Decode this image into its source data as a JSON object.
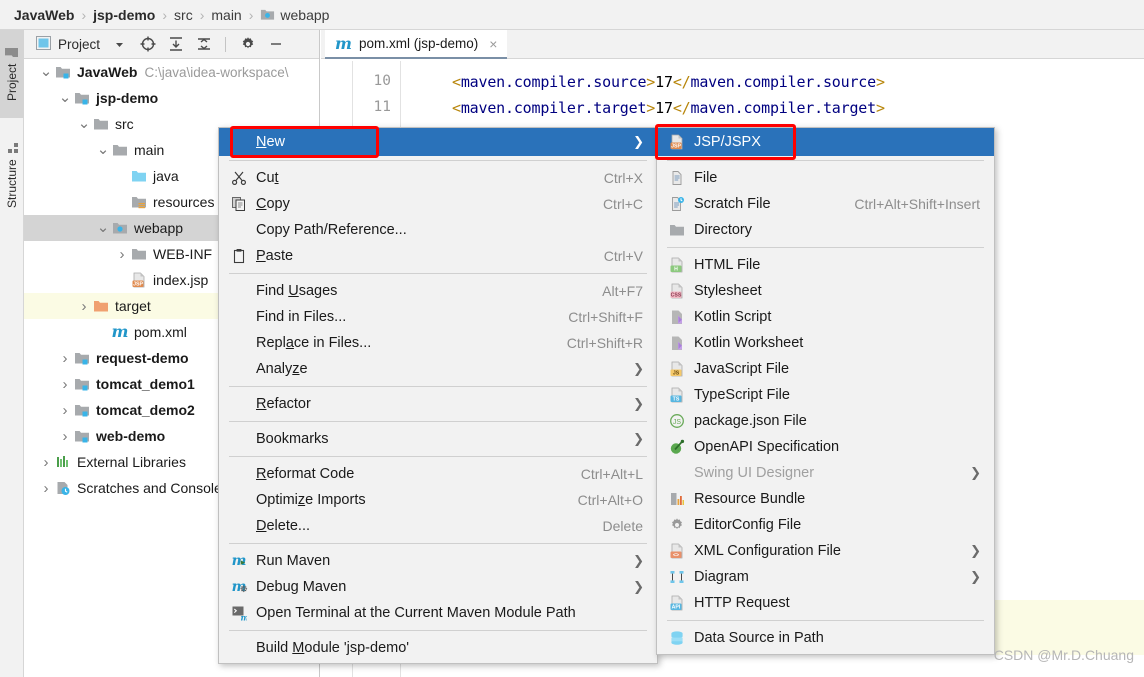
{
  "breadcrumb": {
    "items": [
      {
        "label": "JavaWeb",
        "bold": true,
        "icon": null
      },
      {
        "label": "jsp-demo",
        "bold": true,
        "icon": null
      },
      {
        "label": "src",
        "bold": false,
        "icon": null
      },
      {
        "label": "main",
        "bold": false,
        "icon": null
      },
      {
        "label": "webapp",
        "bold": false,
        "icon": "webapp-folder-icon"
      }
    ],
    "separator": "›"
  },
  "toolstrip": {
    "project_tab": "Project",
    "structure_tab": "Structure"
  },
  "project_panel": {
    "title": "Project",
    "buttons": [
      {
        "name": "project-view-dropdown",
        "glyph": "▾"
      },
      {
        "name": "select-opened-file-icon",
        "glyph": "⊕"
      },
      {
        "name": "expand-all-icon",
        "glyph": "⤓"
      },
      {
        "name": "collapse-all-icon",
        "glyph": "⤒"
      },
      {
        "name": "settings-gear-icon",
        "glyph": "⚙"
      },
      {
        "name": "hide-panel-icon",
        "glyph": "—"
      }
    ],
    "tree": [
      {
        "label": "JavaWeb",
        "path": "C:\\java\\idea-workspace\\",
        "indent": 0,
        "arrow": "⌄",
        "icon": "module-folder-icon",
        "bold": true,
        "state": "none"
      },
      {
        "label": "jsp-demo",
        "path": "",
        "indent": 1,
        "arrow": "⌄",
        "icon": "module-folder-icon",
        "bold": true,
        "state": "none"
      },
      {
        "label": "src",
        "path": "",
        "indent": 2,
        "arrow": "⌄",
        "icon": "folder-icon",
        "bold": false,
        "state": "none"
      },
      {
        "label": "main",
        "path": "",
        "indent": 3,
        "arrow": "⌄",
        "icon": "folder-icon",
        "bold": false,
        "state": "none"
      },
      {
        "label": "java",
        "path": "",
        "indent": 4,
        "arrow": "",
        "icon": "source-folder-icon",
        "bold": false,
        "state": "none"
      },
      {
        "label": "resources",
        "path": "",
        "indent": 4,
        "arrow": "",
        "icon": "resources-folder-icon",
        "bold": false,
        "state": "none"
      },
      {
        "label": "webapp",
        "path": "",
        "indent": 3,
        "arrow": "⌄",
        "icon": "webapp-folder-icon",
        "bold": false,
        "state": "selected"
      },
      {
        "label": "WEB-INF",
        "path": "",
        "indent": 4,
        "arrow": "›",
        "icon": "folder-icon",
        "bold": false,
        "state": "none"
      },
      {
        "label": "index.jsp",
        "path": "",
        "indent": 4,
        "arrow": "",
        "icon": "jsp-file-icon",
        "bold": false,
        "state": "none"
      },
      {
        "label": "target",
        "path": "",
        "indent": 2,
        "arrow": "›",
        "icon": "target-folder-icon",
        "bold": false,
        "state": "highlight"
      },
      {
        "label": "pom.xml",
        "path": "",
        "indent": 3,
        "arrow": "",
        "icon": "maven-file-icon",
        "bold": false,
        "state": "none"
      },
      {
        "label": "request-demo",
        "path": "",
        "indent": 1,
        "arrow": "›",
        "icon": "module-folder-icon",
        "bold": true,
        "state": "none"
      },
      {
        "label": "tomcat_demo1",
        "path": "",
        "indent": 1,
        "arrow": "›",
        "icon": "module-folder-icon",
        "bold": true,
        "state": "none"
      },
      {
        "label": "tomcat_demo2",
        "path": "",
        "indent": 1,
        "arrow": "›",
        "icon": "module-folder-icon",
        "bold": true,
        "state": "none"
      },
      {
        "label": "web-demo",
        "path": "",
        "indent": 1,
        "arrow": "›",
        "icon": "module-folder-icon",
        "bold": true,
        "state": "none"
      },
      {
        "label": "External Libraries",
        "path": "",
        "indent": 0,
        "arrow": "›",
        "icon": "libraries-icon",
        "bold": false,
        "state": "none"
      },
      {
        "label": "Scratches and Consoles",
        "path": "",
        "indent": 0,
        "arrow": "›",
        "icon": "scratches-icon",
        "bold": false,
        "state": "none"
      }
    ]
  },
  "editor": {
    "tab_label": "pom.xml (jsp-demo)",
    "tab_icon": "maven-file-icon",
    "tab_close": "×",
    "lines": [
      {
        "number": "10",
        "open_tag": "<maven.compiler.source>",
        "value": "17",
        "close_tag": "</maven.compiler.source>"
      },
      {
        "number": "11",
        "open_tag": "<maven.compiler.target>",
        "value": "17",
        "close_tag": "</maven.compiler.target>"
      }
    ]
  },
  "context_menu": {
    "items": [
      {
        "label": "New",
        "key": "",
        "icon": null,
        "arrow": true,
        "highlight": true,
        "mnemonic": "N"
      },
      {
        "sep": true
      },
      {
        "label": "Cut",
        "key": "Ctrl+X",
        "icon": "scissors-icon",
        "arrow": false,
        "mnemonic": "t"
      },
      {
        "label": "Copy",
        "key": "Ctrl+C",
        "icon": "copy-icon",
        "arrow": false,
        "mnemonic": "C"
      },
      {
        "label": "Copy Path/Reference...",
        "key": "",
        "icon": null,
        "arrow": false
      },
      {
        "label": "Paste",
        "key": "Ctrl+V",
        "icon": "clipboard-icon",
        "arrow": false,
        "mnemonic": "P"
      },
      {
        "sep": true
      },
      {
        "label": "Find Usages",
        "key": "Alt+F7",
        "icon": null,
        "arrow": false,
        "mnemonic": "U"
      },
      {
        "label": "Find in Files...",
        "key": "Ctrl+Shift+F",
        "icon": null,
        "arrow": false
      },
      {
        "label": "Replace in Files...",
        "key": "Ctrl+Shift+R",
        "icon": null,
        "arrow": false,
        "mnemonic": "a"
      },
      {
        "label": "Analyze",
        "key": "",
        "icon": null,
        "arrow": true,
        "mnemonic": "z"
      },
      {
        "sep": true
      },
      {
        "label": "Refactor",
        "key": "",
        "icon": null,
        "arrow": true,
        "mnemonic": "R"
      },
      {
        "sep": true
      },
      {
        "label": "Bookmarks",
        "key": "",
        "icon": null,
        "arrow": true
      },
      {
        "sep": true
      },
      {
        "label": "Reformat Code",
        "key": "Ctrl+Alt+L",
        "icon": null,
        "arrow": false,
        "mnemonic": "R"
      },
      {
        "label": "Optimize Imports",
        "key": "Ctrl+Alt+O",
        "icon": null,
        "arrow": false,
        "mnemonic": "z"
      },
      {
        "label": "Delete...",
        "key": "Delete",
        "icon": null,
        "arrow": false,
        "mnemonic": "D"
      },
      {
        "sep": true
      },
      {
        "label": "Run Maven",
        "key": "",
        "icon": "maven-run-icon",
        "arrow": true
      },
      {
        "label": "Debug Maven",
        "key": "",
        "icon": "maven-debug-icon",
        "arrow": true
      },
      {
        "label": "Open Terminal at the Current Maven Module Path",
        "key": "",
        "icon": "terminal-maven-icon",
        "arrow": false
      },
      {
        "sep": true
      },
      {
        "label": "Build Module 'jsp-demo'",
        "key": "",
        "icon": null,
        "arrow": false,
        "mnemonic": "M"
      }
    ]
  },
  "submenu": {
    "items": [
      {
        "label": "JSP/JSPX",
        "key": "",
        "icon": "jsp-file-icon",
        "arrow": false,
        "highlight": true
      },
      {
        "sep": true
      },
      {
        "label": "File",
        "key": "",
        "icon": "file-icon",
        "arrow": false
      },
      {
        "label": "Scratch File",
        "key": "Ctrl+Alt+Shift+Insert",
        "icon": "scratch-file-icon",
        "arrow": false
      },
      {
        "label": "Directory",
        "key": "",
        "icon": "directory-icon",
        "arrow": false
      },
      {
        "sep": true
      },
      {
        "label": "HTML File",
        "key": "",
        "icon": "html-file-icon",
        "arrow": false
      },
      {
        "label": "Stylesheet",
        "key": "",
        "icon": "css-file-icon",
        "arrow": false
      },
      {
        "label": "Kotlin Script",
        "key": "",
        "icon": "kotlin-script-icon",
        "arrow": false
      },
      {
        "label": "Kotlin Worksheet",
        "key": "",
        "icon": "kotlin-worksheet-icon",
        "arrow": false
      },
      {
        "label": "JavaScript File",
        "key": "",
        "icon": "js-file-icon",
        "arrow": false
      },
      {
        "label": "TypeScript File",
        "key": "",
        "icon": "ts-file-icon",
        "arrow": false
      },
      {
        "label": "package.json File",
        "key": "",
        "icon": "nodejs-icon",
        "arrow": false
      },
      {
        "label": "OpenAPI Specification",
        "key": "",
        "icon": "openapi-icon",
        "arrow": false
      },
      {
        "label": "Swing UI Designer",
        "key": "",
        "icon": null,
        "arrow": true,
        "disabled": true
      },
      {
        "label": "Resource Bundle",
        "key": "",
        "icon": "resource-bundle-icon",
        "arrow": false
      },
      {
        "label": "EditorConfig File",
        "key": "",
        "icon": "editorconfig-icon",
        "arrow": false
      },
      {
        "label": "XML Configuration File",
        "key": "",
        "icon": "xml-file-icon",
        "arrow": true
      },
      {
        "label": "Diagram",
        "key": "",
        "icon": "diagram-icon",
        "arrow": true
      },
      {
        "label": "HTTP Request",
        "key": "",
        "icon": "http-request-icon",
        "arrow": false
      },
      {
        "sep": true
      },
      {
        "label": "Data Source in Path",
        "key": "",
        "icon": "datasource-icon",
        "arrow": false
      }
    ]
  },
  "annotations": {
    "highlight_color": "#ff0000",
    "boxes": [
      "new-menu-item",
      "jsp-jspx-menu-item"
    ]
  },
  "watermark": {
    "text": "CSDN @Mr.D.Chuang"
  },
  "colors": {
    "menu_highlight": "#2a72ba",
    "selection": "#d4d4d4",
    "tree_highlight": "#fbfbe4",
    "panel_bg": "#f2f2f2"
  }
}
